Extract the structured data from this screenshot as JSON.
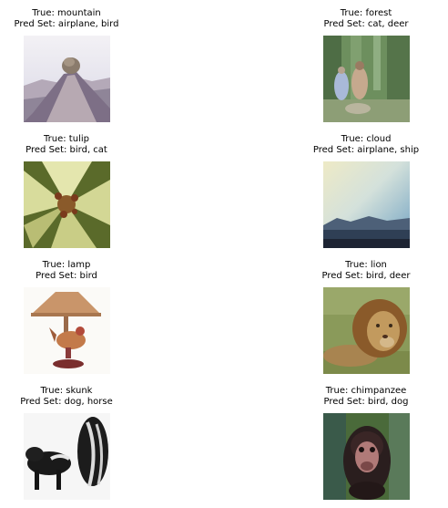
{
  "panels": [
    {
      "true_label": "True: mountain",
      "pred_set": "Pred Set: airplane, bird"
    },
    {
      "true_label": "True: forest",
      "pred_set": "Pred Set: cat, deer"
    },
    {
      "true_label": "True: tulip",
      "pred_set": "Pred Set: bird, cat"
    },
    {
      "true_label": "True: cloud",
      "pred_set": "Pred Set: airplane, ship"
    },
    {
      "true_label": "True: lamp",
      "pred_set": "Pred Set: bird"
    },
    {
      "true_label": "True: lion",
      "pred_set": "Pred Set: bird, deer"
    },
    {
      "true_label": "True: skunk",
      "pred_set": "Pred Set: dog, horse"
    },
    {
      "true_label": "True: chimpanzee",
      "pred_set": "Pred Set: bird, dog"
    }
  ]
}
